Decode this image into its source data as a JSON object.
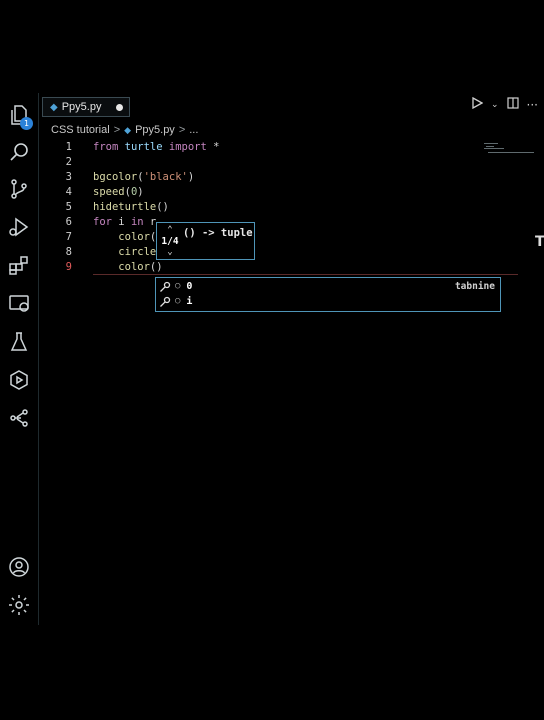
{
  "activity_bar": {
    "items": [
      {
        "icon": "explorer-icon",
        "badge": "1"
      },
      {
        "icon": "search-icon"
      },
      {
        "icon": "source-control-icon"
      },
      {
        "icon": "run-debug-icon"
      },
      {
        "icon": "extensions-icon"
      },
      {
        "icon": "remote-explorer-icon"
      },
      {
        "icon": "testing-icon"
      },
      {
        "icon": "extension-view-icon"
      },
      {
        "icon": "share-icon"
      }
    ],
    "bottom": [
      {
        "icon": "account-icon"
      },
      {
        "icon": "manage-gear-icon"
      }
    ]
  },
  "tab": {
    "name": "Ppy5.py",
    "modified": true
  },
  "breadcrumb": {
    "folder": "CSS tutorial",
    "file": "Ppy5.py",
    "more": "..."
  },
  "editor": {
    "current_line": 9,
    "lines": [
      {
        "n": "1",
        "parts": [
          [
            "kw",
            "from"
          ],
          [
            "t",
            " "
          ],
          [
            "mod",
            "turtle"
          ],
          [
            "t",
            " "
          ],
          [
            "kw",
            "import"
          ],
          [
            "t",
            " *"
          ]
        ]
      },
      {
        "n": "2",
        "parts": []
      },
      {
        "n": "3",
        "parts": [
          [
            "fn",
            "bgcolor"
          ],
          [
            "t",
            "("
          ],
          [
            "str",
            "'black'"
          ],
          [
            "t",
            ")"
          ]
        ]
      },
      {
        "n": "4",
        "parts": [
          [
            "fn",
            "speed"
          ],
          [
            "t",
            "("
          ],
          [
            "num",
            "0"
          ],
          [
            "t",
            ")"
          ]
        ]
      },
      {
        "n": "5",
        "parts": [
          [
            "fn",
            "hideturtle"
          ],
          [
            "t",
            "()"
          ]
        ]
      },
      {
        "n": "6",
        "parts": [
          [
            "kw",
            "for"
          ],
          [
            "t",
            " i "
          ],
          [
            "kw",
            "in"
          ],
          [
            "t",
            " r"
          ]
        ]
      },
      {
        "n": "7",
        "parts": [
          [
            "t",
            "    "
          ],
          [
            "fn",
            "color"
          ],
          [
            "t",
            "("
          ]
        ]
      },
      {
        "n": "8",
        "parts": [
          [
            "t",
            "    "
          ],
          [
            "fn",
            "circle"
          ]
        ]
      },
      {
        "n": "9",
        "parts": [
          [
            "t",
            "    "
          ],
          [
            "fn",
            "color"
          ],
          [
            "t",
            "()"
          ]
        ]
      }
    ]
  },
  "signature_help": {
    "counter": "1/4",
    "signature": "() -> tuple"
  },
  "suggestions": [
    {
      "kind": "○",
      "label": "0",
      "source": "tabnine"
    },
    {
      "kind": "○",
      "label": "i",
      "source": ""
    }
  ],
  "edge_text": "T"
}
